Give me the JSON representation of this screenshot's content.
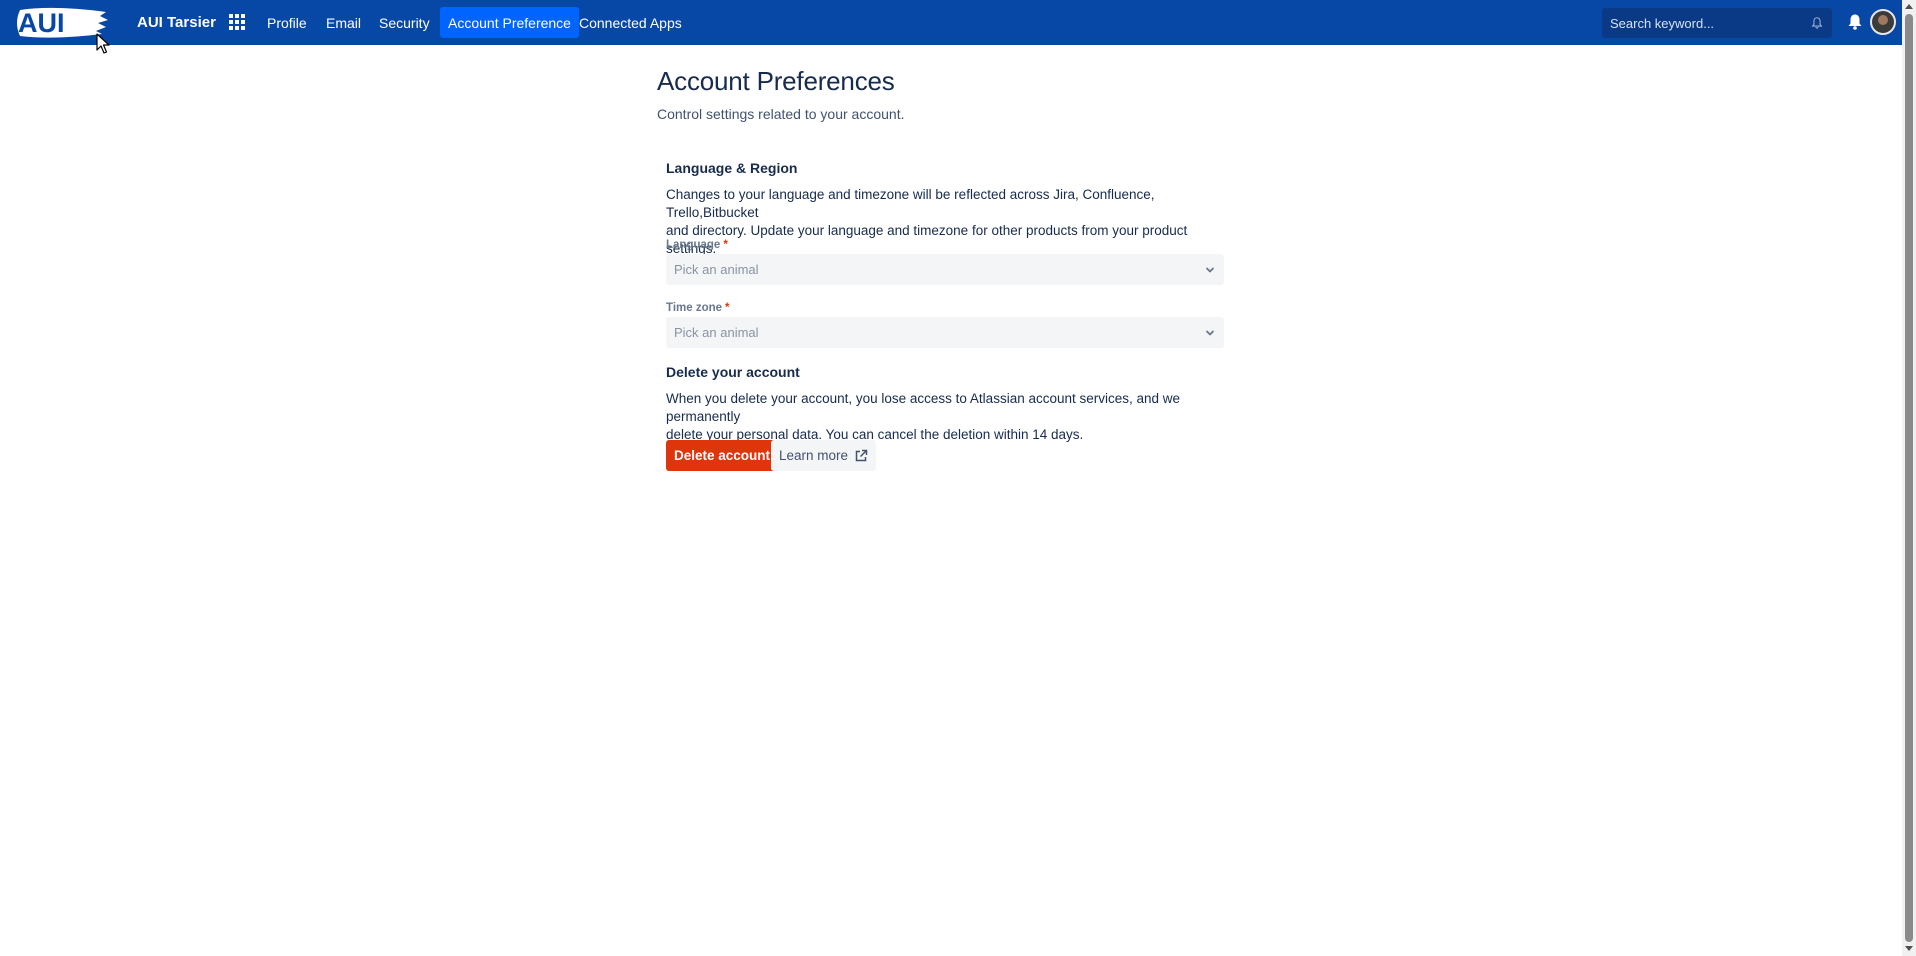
{
  "app": {
    "logo_text": "AUI",
    "product_name": "AUI Tarsier"
  },
  "nav": {
    "items": [
      {
        "label": "Profile",
        "active": false
      },
      {
        "label": "Email",
        "active": false
      },
      {
        "label": "Security",
        "active": false
      },
      {
        "label": "Account Preference",
        "active": true
      },
      {
        "label": "Connected Apps",
        "active": false
      }
    ]
  },
  "search": {
    "placeholder": "Search keyword..."
  },
  "page": {
    "title": "Account Preferences",
    "subtitle": "Control settings related to your account."
  },
  "language_region": {
    "title": "Language & Region",
    "description_line1": "Changes to your language and timezone will be reflected across Jira, Confluence, Trello,Bitbucket",
    "description_line2": "and directory. Update your language and timezone for other products from your product settings.",
    "language_label": "Language",
    "language_placeholder": "Pick an animal",
    "timezone_label": "Time zone",
    "timezone_placeholder": "Pick an animal",
    "required_marker": "*"
  },
  "delete_account": {
    "title": "Delete your account",
    "description_line1": "When you delete your account, you lose access to Atlassian account services, and we permanently",
    "description_line2": "delete your personal data. You can cancel the deletion within 14 days.",
    "delete_button": "Delete account",
    "learn_more_button": "Learn more"
  },
  "colors": {
    "nav_bg": "#0747a6",
    "nav_active": "#0065ff",
    "danger": "#de350b",
    "text": "#172b4d"
  },
  "icons": [
    "app-switcher-icon",
    "notification-bell-icon",
    "bell-icon",
    "chevron-down-icon",
    "external-link-icon"
  ]
}
